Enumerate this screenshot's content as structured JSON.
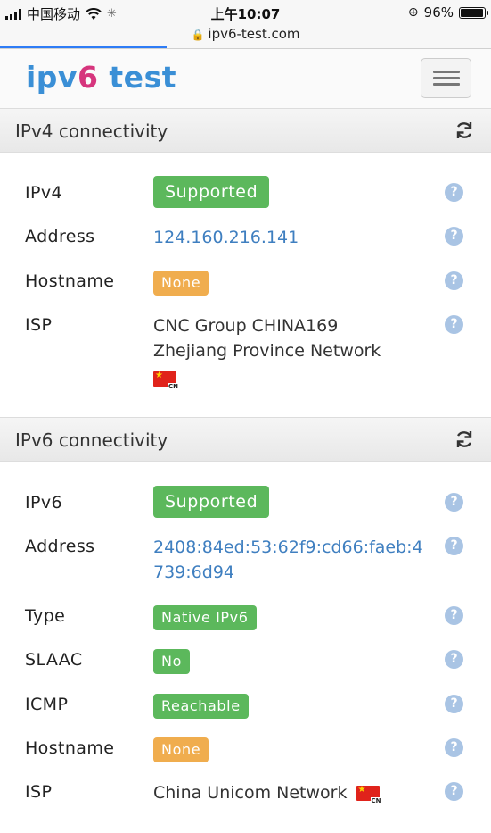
{
  "status_bar": {
    "carrier": "中国移动",
    "time": "上午10:07",
    "battery": "96%",
    "battery_level": 0.96
  },
  "url_bar": {
    "url": "ipv6-test.com",
    "load_progress": 0.34
  },
  "navbar": {
    "brand_part1": "ipv",
    "brand_part2": "6",
    "brand_part3": " test"
  },
  "ipv4": {
    "heading": "IPv4 connectivity",
    "rows": {
      "ipv4": {
        "label": "IPv4",
        "value": "Supported"
      },
      "address": {
        "label": "Address",
        "value": "124.160.216.141"
      },
      "hostname": {
        "label": "Hostname",
        "value": "None"
      },
      "isp": {
        "label": "ISP",
        "value_line1": "CNC Group CHINA169",
        "value_line2": "Zhejiang Province Network",
        "flag_code": "CN"
      }
    }
  },
  "ipv6": {
    "heading": "IPv6 connectivity",
    "rows": {
      "ipv6": {
        "label": "IPv6",
        "value": "Supported"
      },
      "address": {
        "label": "Address",
        "value_line1": "2408:84ed:53:62f9:cd66:faeb:4",
        "value_line2": "739:6d94"
      },
      "type": {
        "label": "Type",
        "value": "Native IPv6"
      },
      "slaac": {
        "label": "SLAAC",
        "value": "No"
      },
      "icmp": {
        "label": "ICMP",
        "value": "Reachable"
      },
      "hostname": {
        "label": "Hostname",
        "value": "None"
      },
      "isp": {
        "label": "ISP",
        "value": "China Unicom Network",
        "flag_code": "CN"
      }
    }
  },
  "help_symbol": "?",
  "colors": {
    "supported_green": "#5cb85c",
    "none_orange": "#f0ad4e",
    "link_blue": "#3f7fc0",
    "help_blue": "#a9c4e4",
    "brand_blue": "#3a8fd6",
    "brand_pink": "#d6357d"
  }
}
